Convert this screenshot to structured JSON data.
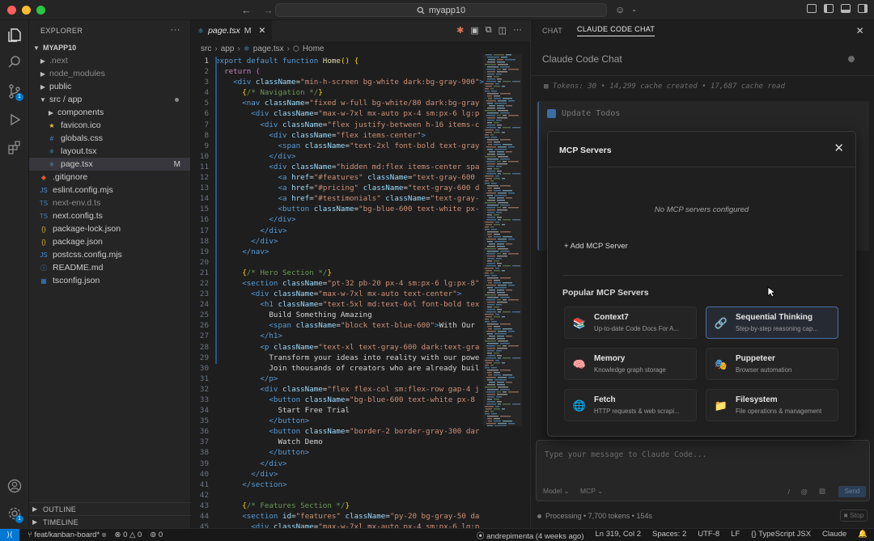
{
  "window": {
    "search_text": "myapp10",
    "colors": {
      "accent": "#0078d4",
      "bg": "#1e1e1e",
      "sidebar": "#252526"
    }
  },
  "explorer": {
    "header": "EXPLORER",
    "root": "MYAPP10",
    "items": [
      {
        "label": ".next",
        "kind": "folder",
        "indent": 1
      },
      {
        "label": "node_modules",
        "kind": "folder",
        "indent": 1
      },
      {
        "label": "public",
        "kind": "folder",
        "indent": 1
      },
      {
        "label": "src / app",
        "kind": "folder-open",
        "indent": 1
      },
      {
        "label": "components",
        "kind": "folder",
        "indent": 2
      },
      {
        "label": "favicon.ico",
        "kind": "ico",
        "indent": 2
      },
      {
        "label": "globals.css",
        "kind": "css",
        "indent": 2
      },
      {
        "label": "layout.tsx",
        "kind": "tsx",
        "indent": 2
      },
      {
        "label": "page.tsx",
        "kind": "tsx",
        "indent": 2
      },
      {
        "label": ".gitignore",
        "kind": "git",
        "indent": 1
      },
      {
        "label": "eslint.config.mjs",
        "kind": "js",
        "indent": 1
      },
      {
        "label": "next-env.d.ts",
        "kind": "ts",
        "indent": 1
      },
      {
        "label": "next.config.ts",
        "kind": "ts",
        "indent": 1
      },
      {
        "label": "package-lock.json",
        "kind": "json",
        "indent": 1
      },
      {
        "label": "package.json",
        "kind": "json",
        "indent": 1
      },
      {
        "label": "postcss.config.mjs",
        "kind": "js",
        "indent": 1
      },
      {
        "label": "README.md",
        "kind": "md",
        "indent": 1
      },
      {
        "label": "tsconfig.json",
        "kind": "tsjson",
        "indent": 1
      }
    ],
    "modified_flag": "M",
    "outline": "OUTLINE",
    "timeline": "TIMELINE"
  },
  "editor": {
    "tab_label": "page.tsx",
    "tab_flag": "M",
    "breadcrumb": [
      "src",
      "app",
      "page.tsx",
      "Home"
    ]
  },
  "chat": {
    "tabs": [
      "CHAT",
      "CLAUDE CODE CHAT"
    ],
    "title": "Claude Code Chat",
    "tokens": "Tokens: 30 • 14,299 cache created • 17,687 cache read",
    "todo_title": "Update Todos",
    "input_placeholder": "Type your message to Claude Code...",
    "model_label": "Model",
    "mcp_label": "MCP",
    "send_label": "Send",
    "processing": "Processing • 7,700 tokens • 154s",
    "stop_label": "Stop"
  },
  "mcp_modal": {
    "title": "MCP Servers",
    "empty_message": "No MCP servers configured",
    "add_button": "+ Add MCP Server",
    "popular_title": "Popular MCP Servers",
    "servers": [
      {
        "name": "Context7",
        "desc": "Up-to-date Code Docs For A...",
        "icon": "books-icon"
      },
      {
        "name": "Sequential Thinking",
        "desc": "Step-by-step reasoning cap...",
        "icon": "link-icon"
      },
      {
        "name": "Memory",
        "desc": "Knowledge graph storage",
        "icon": "brain-icon"
      },
      {
        "name": "Puppeteer",
        "desc": "Browser automation",
        "icon": "puppet-icon"
      },
      {
        "name": "Fetch",
        "desc": "HTTP requests & web scrapi...",
        "icon": "globe-icon"
      },
      {
        "name": "Filesystem",
        "desc": "File operations & management",
        "icon": "folder-icon"
      }
    ]
  },
  "statusbar": {
    "branch": "feat/kanban-board*",
    "problems": "0 △ 0",
    "ports": "0",
    "blame": "andrepimenta (4 weeks ago)",
    "cursor_pos": "Ln 319, Col 2",
    "spaces": "Spaces: 2",
    "encoding": "UTF-8",
    "eol": "LF",
    "language": "TypeScript JSX",
    "extension": "Claude"
  }
}
